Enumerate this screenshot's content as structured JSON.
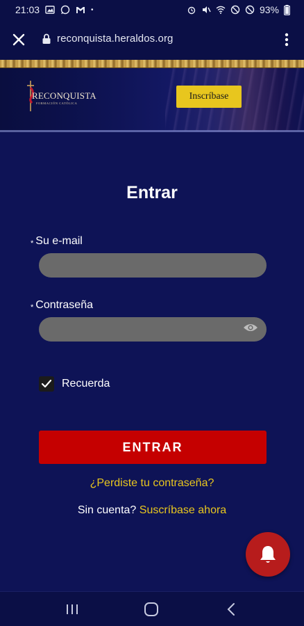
{
  "status_bar": {
    "time": "21:03",
    "battery": "93%"
  },
  "browser": {
    "url": "reconquista.heraldos.org"
  },
  "banner": {
    "logo_text": "RECONQUISTA",
    "logo_subtext": "FORMACIÓN CATÓLICA",
    "subscribe_label": "Inscríbase"
  },
  "form": {
    "title": "Entrar",
    "email_label": "Su e-mail",
    "email_value": "",
    "password_label": "Contraseña",
    "password_value": "",
    "remember_label": "Recuerda",
    "remember_checked": true,
    "submit_label": "ENTRAR",
    "forgot_label": "¿Perdiste tu contraseña?",
    "no_account_label": "Sin cuenta?",
    "signup_label": "Suscríbase ahora",
    "required_marker": "*"
  },
  "colors": {
    "background": "#0e1356",
    "accent_yellow": "#e8c61e",
    "submit_red": "#c50000",
    "fab_red": "#b71c1c",
    "field_gray": "#6a6a6a"
  },
  "icons": [
    "close-icon",
    "lock-icon",
    "more-vert-icon",
    "eye-icon",
    "check-icon",
    "bell-icon",
    "recents-icon",
    "home-icon",
    "back-icon"
  ]
}
